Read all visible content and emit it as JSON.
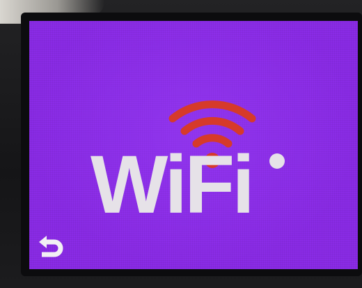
{
  "screen": {
    "logo_text": "WiFi",
    "background_color": "#8a2be6",
    "text_color": "#e6e2e8",
    "signal_color": "#d63a2a"
  },
  "icons": {
    "wifi_signal": "wifi-signal-icon",
    "back": "back-arrow-icon"
  }
}
